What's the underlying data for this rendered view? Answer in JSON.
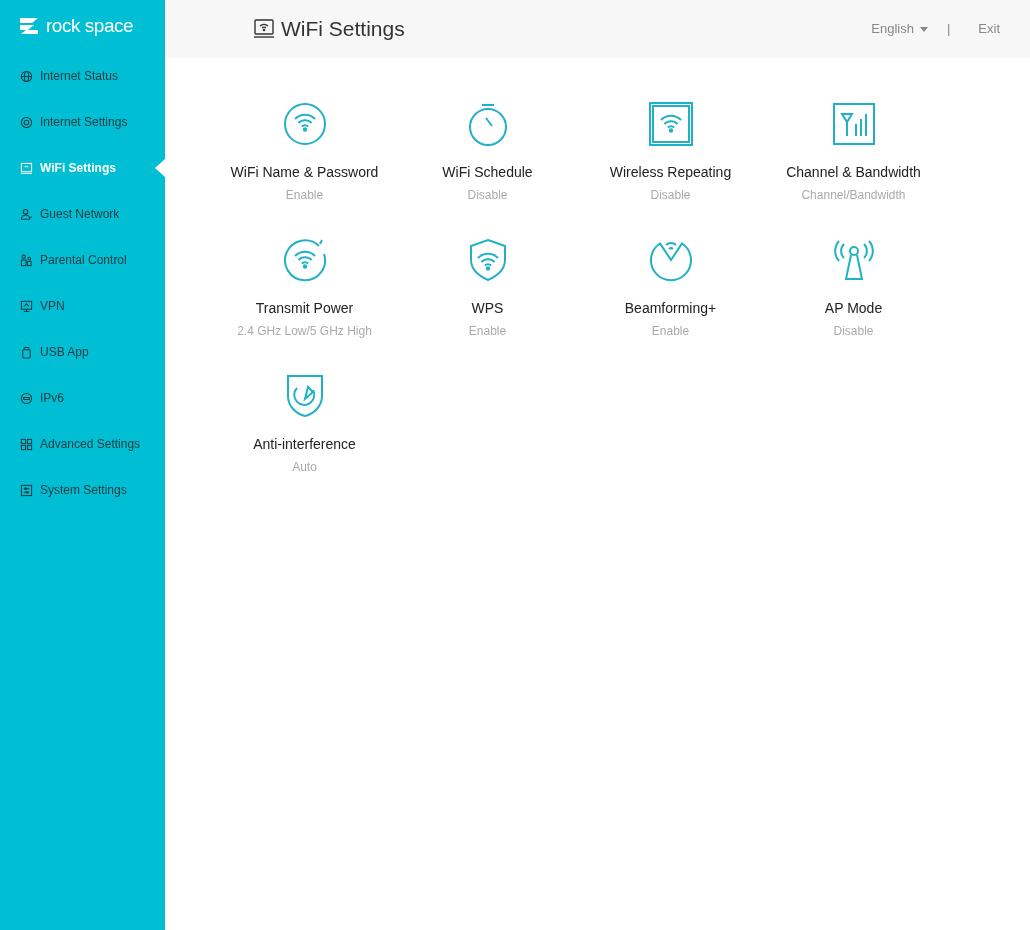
{
  "logo": {
    "text": "rock space"
  },
  "sidebar": {
    "items": [
      {
        "label": "Internet Status",
        "kind": "globe",
        "selected": false
      },
      {
        "label": "Internet Settings",
        "kind": "gear",
        "selected": false
      },
      {
        "label": "WiFi Settings",
        "kind": "monitor",
        "selected": true
      },
      {
        "label": "Guest Network",
        "kind": "person",
        "selected": false
      },
      {
        "label": "Parental Control",
        "kind": "family",
        "selected": false
      },
      {
        "label": "VPN",
        "kind": "screen",
        "selected": false
      },
      {
        "label": "USB App",
        "kind": "usb",
        "selected": false
      },
      {
        "label": "IPv6",
        "kind": "ipv6",
        "selected": false
      },
      {
        "label": "Advanced Settings",
        "kind": "grid",
        "selected": false
      },
      {
        "label": "System Settings",
        "kind": "sliders",
        "selected": false
      }
    ]
  },
  "header": {
    "title": "WiFi Settings",
    "language": "English",
    "separator": "|",
    "exit": "Exit"
  },
  "tiles": [
    {
      "title": "WiFi Name & Password",
      "status": "Enable",
      "kind": "wifi"
    },
    {
      "title": "WiFi Schedule",
      "status": "Disable",
      "kind": "clock"
    },
    {
      "title": "Wireless Repeating",
      "status": "Disable",
      "kind": "repeater"
    },
    {
      "title": "Channel & Bandwidth",
      "status": "Channel/Bandwidth",
      "kind": "channel"
    },
    {
      "title": "Transmit Power",
      "status": "2.4 GHz Low/5 GHz High",
      "kind": "power"
    },
    {
      "title": "WPS",
      "status": "Enable",
      "kind": "shield"
    },
    {
      "title": "Beamforming+",
      "status": "Enable",
      "kind": "beam"
    },
    {
      "title": "AP Mode",
      "status": "Disable",
      "kind": "antenna"
    },
    {
      "title": "Anti-interference",
      "status": "Auto",
      "kind": "anti"
    }
  ]
}
